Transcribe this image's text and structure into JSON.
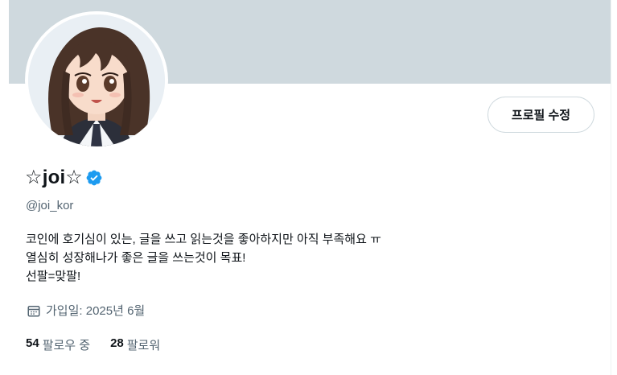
{
  "profile": {
    "display_name": "☆joi☆",
    "handle": "@joi_kor",
    "edit_button_label": "프로필 수정",
    "bio_lines": [
      "코인에 호기심이 있는, 글을 쓰고 읽는것을 좋아하지만 아직 부족해요 ㅠ",
      "열심히 성장해나가 좋은 글을 쓰는것이 목표!",
      "선팔=맞팔!"
    ],
    "joined_text": "가입일: 2025년 6월",
    "following": {
      "count": "54",
      "label": "팔로우 중"
    },
    "followers": {
      "count": "28",
      "label": "팔로워"
    }
  },
  "colors": {
    "banner": "#cfd9de",
    "verified_badge": "#1d9bf0",
    "secondary_text": "#536471",
    "primary_text": "#0f1419"
  },
  "icons": {
    "verified": "verified-badge-icon",
    "calendar": "calendar-icon"
  }
}
